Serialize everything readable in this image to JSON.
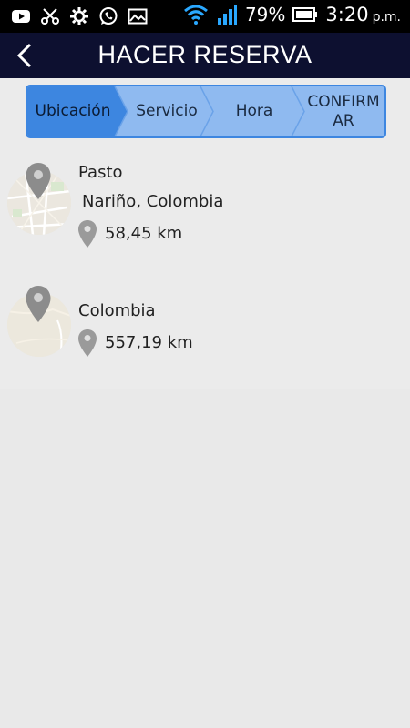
{
  "status_bar": {
    "battery_percent": "79%",
    "time": "3:20",
    "ampm": "p.m.",
    "icons": [
      "youtube-icon",
      "scissors-icon",
      "gear-icon",
      "whatsapp-icon",
      "gallery-icon",
      "wifi-icon",
      "signal-icon",
      "battery-icon"
    ]
  },
  "app_bar": {
    "title": "HACER RESERVA",
    "back_icon": "back-arrow-icon"
  },
  "stepper": {
    "steps": [
      {
        "label": "Ubicación",
        "active": true
      },
      {
        "label": "Servicio",
        "active": false
      },
      {
        "label": "Hora",
        "active": false
      },
      {
        "label": "CONFIRM AR",
        "line1": "CONFIRM",
        "line2": "AR",
        "active": false
      }
    ],
    "colors": {
      "active": "#3d86e0",
      "inactive": "#8fbaf0"
    }
  },
  "locations": [
    {
      "name": "Pasto",
      "subtitle": "Nariño, Colombia",
      "distance": "58,45 km"
    },
    {
      "name": "Colombia",
      "distance": "557,19 km"
    }
  ],
  "colors": {
    "app_bar": "#0d1030",
    "status_bar": "#000000",
    "background": "#ececec",
    "pin_gray": "#9a9a9a"
  }
}
